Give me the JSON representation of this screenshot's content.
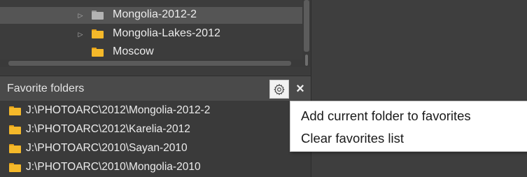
{
  "tree": {
    "items": [
      {
        "label": "Mongolia-2012-2",
        "has_arrow": true,
        "selected": true,
        "icon": "folder-grey-icon"
      },
      {
        "label": "Mongolia-Lakes-2012",
        "has_arrow": true,
        "selected": false,
        "icon": "folder-icon"
      },
      {
        "label": "Moscow",
        "has_arrow": false,
        "selected": false,
        "icon": "folder-icon"
      }
    ]
  },
  "favorites": {
    "title": "Favorite folders",
    "settings_icon": "gear-icon",
    "close_label": "×",
    "items": [
      {
        "label": "J:\\PHOTOARC\\2012\\Mongolia-2012-2"
      },
      {
        "label": "J:\\PHOTOARC\\2012\\Karelia-2012"
      },
      {
        "label": "J:\\PHOTOARC\\2010\\Sayan-2010"
      },
      {
        "label": "J:\\PHOTOARC\\2010\\Mongolia-2010"
      }
    ]
  },
  "context_menu": {
    "items": [
      {
        "label": "Add current folder to favorites"
      },
      {
        "label": "Clear favorites list"
      }
    ]
  },
  "colors": {
    "folder": "#f5b92a",
    "panel_bg": "#3c3c3c",
    "header_bg": "#4a4a4a",
    "selection_bg": "#555555",
    "menu_bg": "#ffffff"
  }
}
